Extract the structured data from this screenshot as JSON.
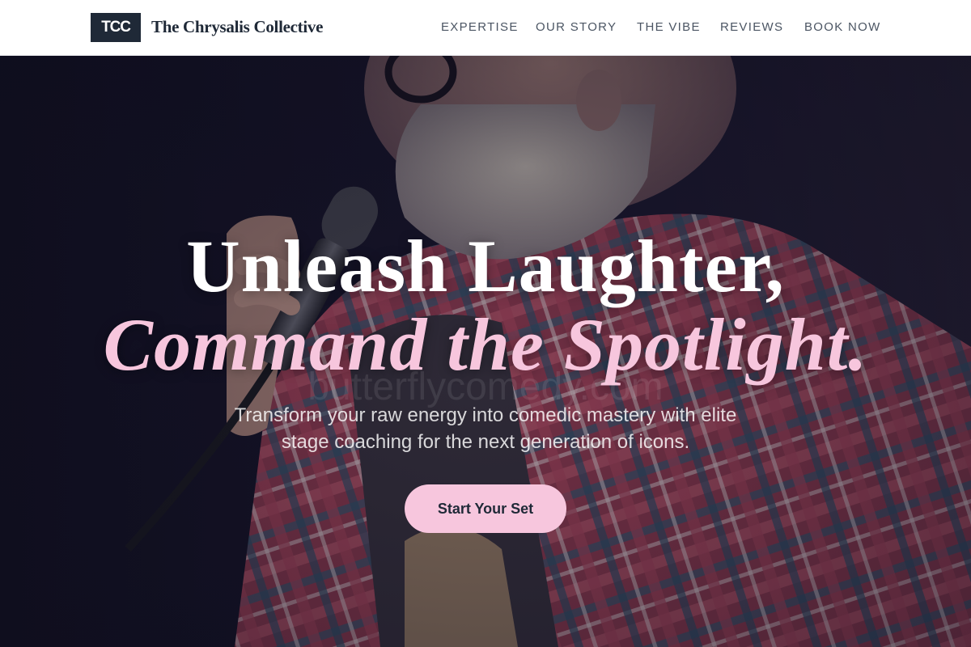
{
  "brand": {
    "logo_text": "TCC",
    "name": "The Chrysalis Collective"
  },
  "nav": {
    "items": [
      {
        "label": "EXPERTISE"
      },
      {
        "label": "OUR STORY"
      },
      {
        "label": "THE VIBE"
      },
      {
        "label": "REVIEWS"
      },
      {
        "label": "BOOK NOW"
      }
    ]
  },
  "hero": {
    "headline_line1": "Unleash Laughter,",
    "headline_line2": "Command the Spotlight.",
    "watermark": "butterflycomedy.com",
    "subtitle": "Transform your raw energy into comedic mastery with elite stage coaching for the next generation of icons.",
    "cta_label": "Start Your Set",
    "image": "comedian-with-microphone-photo"
  },
  "colors": {
    "accent": "#f7c6dd",
    "navy": "#1f2937",
    "nav_text": "#4b5563",
    "background": "#ffffff"
  }
}
